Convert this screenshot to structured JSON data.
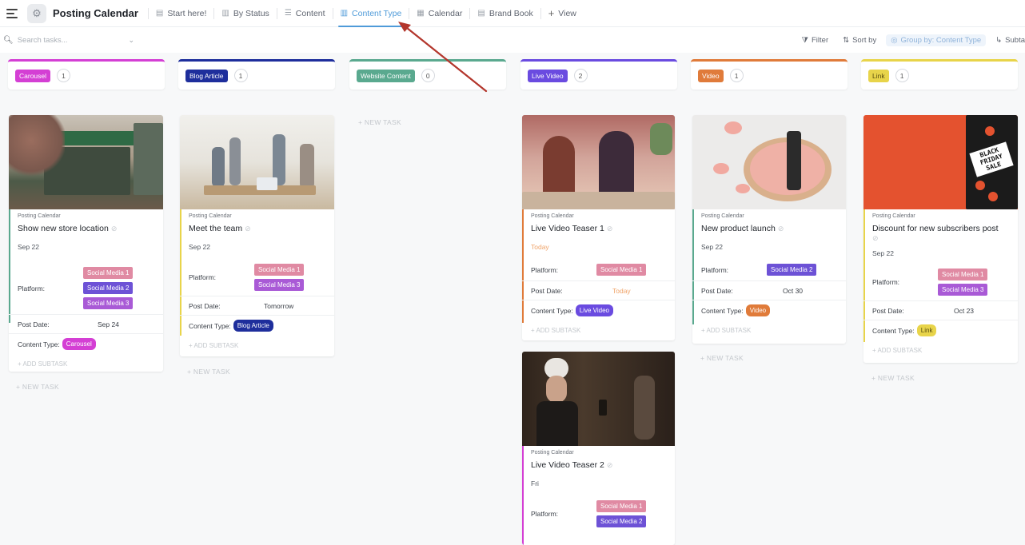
{
  "app": {
    "title": "Posting Calendar"
  },
  "tabs": [
    {
      "label": "Start here!",
      "icon": "doc-icon"
    },
    {
      "label": "By Status",
      "icon": "board-icon"
    },
    {
      "label": "Content",
      "icon": "list-icon"
    },
    {
      "label": "Content Type",
      "icon": "board-icon",
      "active": true
    },
    {
      "label": "Calendar",
      "icon": "calendar-icon"
    },
    {
      "label": "Brand Book",
      "icon": "doc-icon"
    },
    {
      "label": "View",
      "icon": "plus-icon"
    }
  ],
  "toolbar": {
    "search_placeholder": "Search tasks...",
    "filter": "Filter",
    "sort": "Sort by",
    "group": "Group by: Content Type",
    "subtasks": "Subta"
  },
  "columns": [
    {
      "label": "Carousel",
      "count": "1",
      "color": "#d43fd4"
    },
    {
      "label": "Blog Article",
      "count": "1",
      "color": "#1e2e9c"
    },
    {
      "label": "Website Content",
      "count": "0",
      "color": "#5aa98f"
    },
    {
      "label": "Live Video",
      "count": "2",
      "color": "#6a4be0"
    },
    {
      "label": "Video",
      "count": "1",
      "color": "#e07b3a"
    },
    {
      "label": "Link",
      "count": "1",
      "color": "#e8d44a"
    }
  ],
  "common": {
    "list_name": "Posting Calendar",
    "platform_label": "Platform:",
    "post_date_label": "Post Date:",
    "content_type_label": "Content Type:",
    "add_subtask": "+ ADD SUBTASK",
    "new_task": "+ NEW TASK"
  },
  "cards": {
    "store": {
      "title": "Show new store location",
      "date": "Sep 22",
      "platforms": [
        "Social Media 1",
        "Social Media 2",
        "Social Media 3"
      ],
      "post_date": "Sep 24",
      "content_type": "Carousel"
    },
    "team": {
      "title": "Meet the team",
      "date": "Sep 22",
      "platforms": [
        "Social Media 1",
        "Social Media 3"
      ],
      "post_date": "Tomorrow",
      "content_type": "Blog Article"
    },
    "teaser1": {
      "title": "Live Video Teaser 1",
      "date": "Today",
      "platforms": [
        "Social Media 1"
      ],
      "post_date": "Today",
      "content_type": "Live Video"
    },
    "teaser2": {
      "title": "Live Video Teaser 2",
      "date": "Fri",
      "platforms": [
        "Social Media 1",
        "Social Media 2"
      ]
    },
    "launch": {
      "title": "New product launch",
      "date": "Sep 22",
      "platforms": [
        "Social Media 2"
      ],
      "post_date": "Oct 30",
      "content_type": "Video"
    },
    "discount": {
      "title": "Discount for new subscribers post",
      "date": "Sep 22",
      "platforms": [
        "Social Media 1",
        "Social Media 3"
      ],
      "post_date": "Oct 23",
      "content_type": "Link",
      "image_text": "BLACK FRIDAY SALE"
    }
  }
}
